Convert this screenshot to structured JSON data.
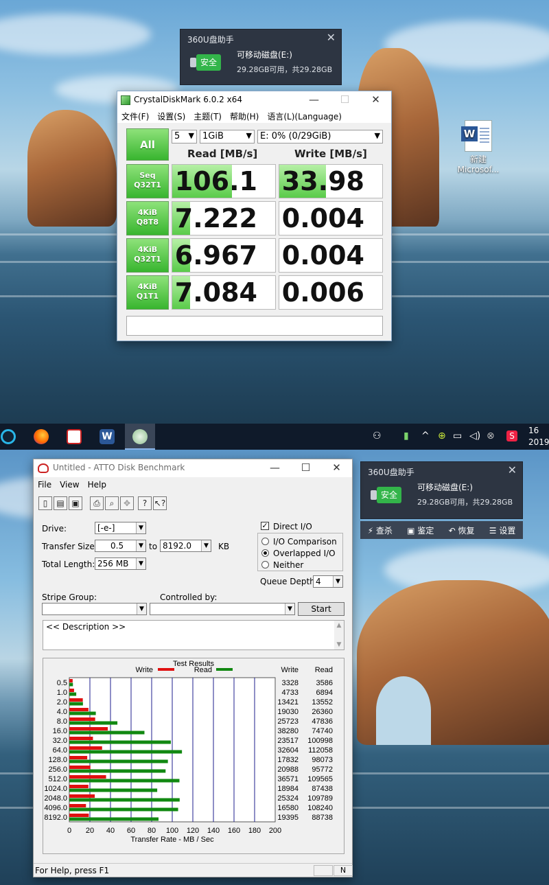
{
  "popup_top": {
    "title": "360U盘助手",
    "safe_label": "安全",
    "drive_name": "可移动磁盘(E:)",
    "capacity": "29.28GB可用，共29.28GB"
  },
  "popup_bottom": {
    "title": "360U盘助手",
    "safe_label": "安全",
    "drive_name": "可移动磁盘(E:)",
    "capacity": "29.28GB可用，共29.28GB",
    "actions": [
      "查杀",
      "鉴定",
      "恢复",
      "设置"
    ]
  },
  "desktop_icon": {
    "line1": "新建",
    "line2": "Microsof..."
  },
  "cdm": {
    "title": "CrystalDiskMark 6.0.2 x64",
    "menu": [
      "文件(F)",
      "设置(S)",
      "主题(T)",
      "帮助(H)",
      "语言(L)(Language)"
    ],
    "all_label": "All",
    "count": "5",
    "size": "1GiB",
    "drive": "E: 0% (0/29GiB)",
    "read_header": "Read [MB/s]",
    "write_header": "Write [MB/s]",
    "rows": [
      {
        "line1": "Seq",
        "line2": "Q32T1",
        "read": "106.1",
        "write": "33.98",
        "read_fill": 0.58,
        "write_fill": 0.45
      },
      {
        "line1": "4KiB",
        "line2": "Q8T8",
        "read": "7.222",
        "write": "0.004",
        "read_fill": 0.17,
        "write_fill": 0
      },
      {
        "line1": "4KiB",
        "line2": "Q32T1",
        "read": "6.967",
        "write": "0.004",
        "read_fill": 0.17,
        "write_fill": 0
      },
      {
        "line1": "4KiB",
        "line2": "Q1T1",
        "read": "7.084",
        "write": "0.006",
        "read_fill": 0.17,
        "write_fill": 0
      }
    ]
  },
  "taskbar": {
    "clock_time": "16",
    "clock_date": "2019/"
  },
  "atto": {
    "title": "Untitled - ATTO Disk Benchmark",
    "menu": [
      "File",
      "View",
      "Help"
    ],
    "drive_label": "Drive:",
    "drive_value": "[-e-]",
    "transfer_size_label": "Transfer Size:",
    "transfer_from": "0.5",
    "to_label": "to",
    "transfer_to": "8192.0",
    "kb_label": "KB",
    "total_length_label": "Total Length:",
    "total_length_value": "256 MB",
    "direct_io_label": "Direct I/O",
    "io_comparison_label": "I/O Comparison",
    "overlapped_io_label": "Overlapped I/O",
    "neither_label": "Neither",
    "queue_depth_label": "Queue Depth:",
    "queue_depth_value": "4",
    "stripe_group_label": "Stripe Group:",
    "controlled_by_label": "Controlled by:",
    "start_label": "Start",
    "description": "<< Description >>",
    "status": "For Help, press F1",
    "status_pane": "N"
  },
  "chart_data": {
    "type": "bar",
    "title": "Test Results",
    "xlabel": "Transfer Rate - MB / Sec",
    "xlim": [
      0,
      200
    ],
    "xticks": [
      "0",
      "20",
      "40",
      "60",
      "80",
      "100",
      "120",
      "140",
      "160",
      "180",
      "200"
    ],
    "legend_write": "Write",
    "legend_read": "Read",
    "col_write": "Write",
    "col_read": "Read",
    "colors": {
      "write": "#e01010",
      "read": "#118811",
      "grid": "#1c1c8c"
    },
    "categories": [
      "0.5",
      "1.0",
      "2.0",
      "4.0",
      "8.0",
      "16.0",
      "32.0",
      "64.0",
      "128.0",
      "256.0",
      "512.0",
      "1024.0",
      "2048.0",
      "4096.0",
      "8192.0"
    ],
    "series": [
      {
        "name": "Write",
        "values": [
          3328,
          4733,
          13421,
          19030,
          25723,
          38280,
          23517,
          32604,
          17832,
          20988,
          36571,
          18984,
          25324,
          16580,
          19395
        ]
      },
      {
        "name": "Read",
        "values": [
          3586,
          6894,
          13552,
          26360,
          47836,
          74740,
          100998,
          112058,
          98073,
          95772,
          109565,
          87438,
          109789,
          108240,
          88738
        ]
      }
    ]
  }
}
